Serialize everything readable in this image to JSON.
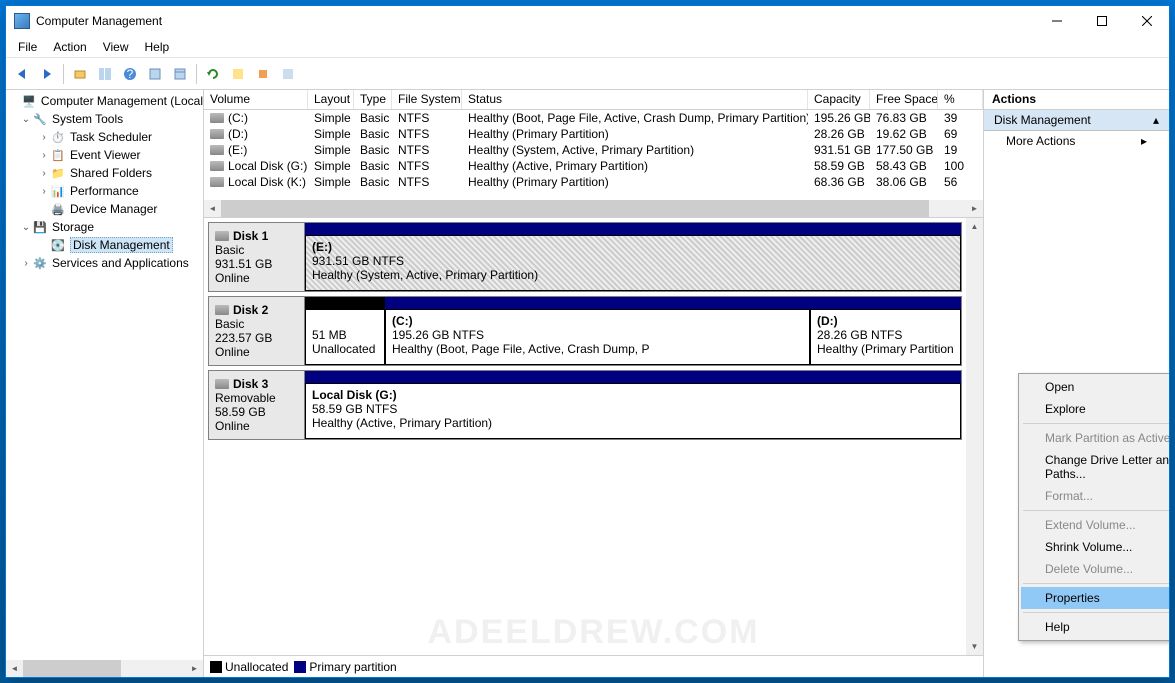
{
  "window": {
    "title": "Computer Management"
  },
  "menu": {
    "file": "File",
    "action": "Action",
    "view": "View",
    "help": "Help"
  },
  "tree": {
    "root": "Computer Management (Local",
    "system_tools": "System Tools",
    "task_scheduler": "Task Scheduler",
    "event_viewer": "Event Viewer",
    "shared_folders": "Shared Folders",
    "performance": "Performance",
    "device_manager": "Device Manager",
    "storage": "Storage",
    "disk_management": "Disk Management",
    "services": "Services and Applications"
  },
  "volcols": {
    "volume": "Volume",
    "layout": "Layout",
    "type": "Type",
    "fs": "File System",
    "status": "Status",
    "capacity": "Capacity",
    "free": "Free Space",
    "pct": "%"
  },
  "volumes": [
    {
      "name": "(C:)",
      "layout": "Simple",
      "type": "Basic",
      "fs": "NTFS",
      "status": "Healthy (Boot, Page File, Active, Crash Dump, Primary Partition)",
      "capacity": "195.26 GB",
      "free": "76.83 GB",
      "pct": "39"
    },
    {
      "name": "(D:)",
      "layout": "Simple",
      "type": "Basic",
      "fs": "NTFS",
      "status": "Healthy (Primary Partition)",
      "capacity": "28.26 GB",
      "free": "19.62 GB",
      "pct": "69"
    },
    {
      "name": "(E:)",
      "layout": "Simple",
      "type": "Basic",
      "fs": "NTFS",
      "status": "Healthy (System, Active, Primary Partition)",
      "capacity": "931.51 GB",
      "free": "177.50 GB",
      "pct": "19"
    },
    {
      "name": "Local Disk (G:)",
      "layout": "Simple",
      "type": "Basic",
      "fs": "NTFS",
      "status": "Healthy (Active, Primary Partition)",
      "capacity": "58.59 GB",
      "free": "58.43 GB",
      "pct": "100"
    },
    {
      "name": "Local Disk (K:)",
      "layout": "Simple",
      "type": "Basic",
      "fs": "NTFS",
      "status": "Healthy (Primary Partition)",
      "capacity": "68.36 GB",
      "free": "38.06 GB",
      "pct": "56"
    }
  ],
  "disks": {
    "d1": {
      "name": "Disk 1",
      "type": "Basic",
      "size": "931.51 GB",
      "state": "Online",
      "p1": {
        "name": "(E:)",
        "info": "931.51 GB NTFS",
        "status": "Healthy (System, Active, Primary Partition)"
      }
    },
    "d2": {
      "name": "Disk 2",
      "type": "Basic",
      "size": "223.57 GB",
      "state": "Online",
      "p0": {
        "info": "51 MB",
        "status": "Unallocated"
      },
      "p1": {
        "name": "(C:)",
        "info": "195.26 GB NTFS",
        "status": "Healthy (Boot, Page File, Active, Crash Dump, P"
      },
      "p2": {
        "name": "(D:)",
        "info": "28.26 GB NTFS",
        "status": "Healthy (Primary Partition"
      }
    },
    "d3": {
      "name": "Disk 3",
      "type": "Removable",
      "size": "58.59 GB",
      "state": "Online",
      "p1": {
        "name": "Local Disk  (G:)",
        "info": "58.59 GB NTFS",
        "status": "Healthy (Active, Primary Partition)"
      }
    }
  },
  "legend": {
    "unalloc": "Unallocated",
    "primary": "Primary partition"
  },
  "actions": {
    "title": "Actions",
    "dm": "Disk Management",
    "more": "More Actions"
  },
  "ctx": {
    "open": "Open",
    "explore": "Explore",
    "mark": "Mark Partition as Active",
    "change": "Change Drive Letter and Paths...",
    "format": "Format...",
    "extend": "Extend Volume...",
    "shrink": "Shrink Volume...",
    "delete": "Delete Volume...",
    "props": "Properties",
    "help": "Help"
  },
  "watermark": "ADEELDREW.COM"
}
